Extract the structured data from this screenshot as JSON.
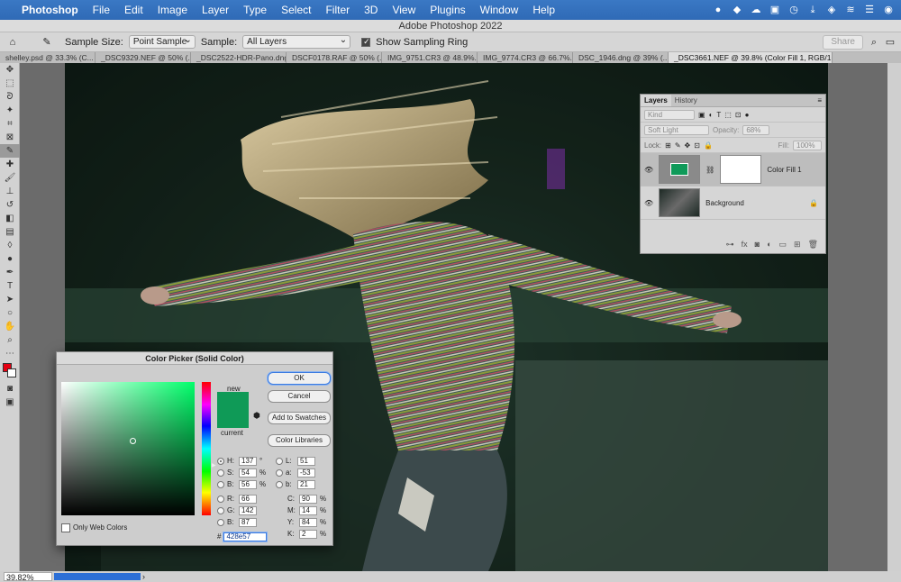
{
  "menubar": {
    "app": "Photoshop",
    "items": [
      "File",
      "Edit",
      "Image",
      "Layer",
      "Type",
      "Select",
      "Filter",
      "3D",
      "View",
      "Plugins",
      "Window",
      "Help"
    ]
  },
  "window": {
    "title": "Adobe Photoshop 2022"
  },
  "options": {
    "sample_size_label": "Sample Size:",
    "sample_size_value": "Point Sample",
    "sample_label": "Sample:",
    "sample_value": "All Layers",
    "show_ring_label": "Show Sampling Ring",
    "share": "Share"
  },
  "tabs": [
    "shelley.psd @ 33.3% (C...",
    "_DSC9329.NEF @ 50% (...",
    "_DSC2522-HDR-Pano.dng",
    "DSCF0178.RAF @ 50% (...",
    "IMG_9751.CR3 @ 48.9%...",
    "IMG_9774.CR3 @ 66.7%...",
    "DSC_1946.dng @ 39% (...",
    "_DSC3661.NEF @ 39.8% (Color Fill 1, RGB/16*) *"
  ],
  "status": {
    "zoom": "39.82%"
  },
  "layers": {
    "tabs": [
      "Layers",
      "History"
    ],
    "filter": "Kind",
    "blend_mode": "Soft Light",
    "opacity_label": "Opacity:",
    "opacity": "68%",
    "lock_label": "Lock:",
    "fill_label": "Fill:",
    "fill": "100%",
    "items": [
      {
        "name": "Color Fill 1",
        "swatch": "#0f9a59"
      },
      {
        "name": "Background"
      }
    ]
  },
  "picker": {
    "title": "Color Picker (Solid Color)",
    "buttons": {
      "ok": "OK",
      "cancel": "Cancel",
      "add": "Add to Swatches",
      "libraries": "Color Libraries"
    },
    "new_label": "new",
    "current_label": "current",
    "new_color": "#0f9a57",
    "current_color": "#0f9a57",
    "only_web": "Only Web Colors",
    "hsb": {
      "H": "137",
      "S": "54",
      "B": "56"
    },
    "rgb": {
      "R": "66",
      "G": "142",
      "B": "87"
    },
    "lab": {
      "L": "51",
      "a": "-53",
      "b": "21"
    },
    "cmyk": {
      "C": "90",
      "M": "14",
      "Y": "84",
      "K": "2"
    },
    "units": {
      "deg": "°",
      "pct": "%"
    },
    "hex_label": "#",
    "hex": "428e57"
  }
}
